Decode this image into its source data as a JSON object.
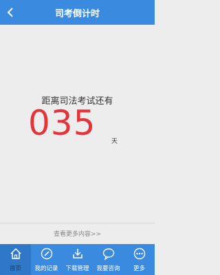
{
  "header": {
    "title": "司考倒计时"
  },
  "countdown": {
    "headline": "距离司法考试还有",
    "days": "035",
    "unit": "天"
  },
  "footer_link": "查看更多内容>>",
  "tabs": [
    {
      "label": "首页",
      "icon": "home-icon",
      "active": true
    },
    {
      "label": "我的记录",
      "icon": "edit-icon",
      "active": false
    },
    {
      "label": "下载管理",
      "icon": "download-icon",
      "active": false
    },
    {
      "label": "我要咨询",
      "icon": "chat-icon",
      "active": false
    },
    {
      "label": "更多",
      "icon": "more-icon",
      "active": false
    }
  ],
  "colors": {
    "brand_blue": "#3a8be0",
    "countdown_red": "#e2353a"
  }
}
